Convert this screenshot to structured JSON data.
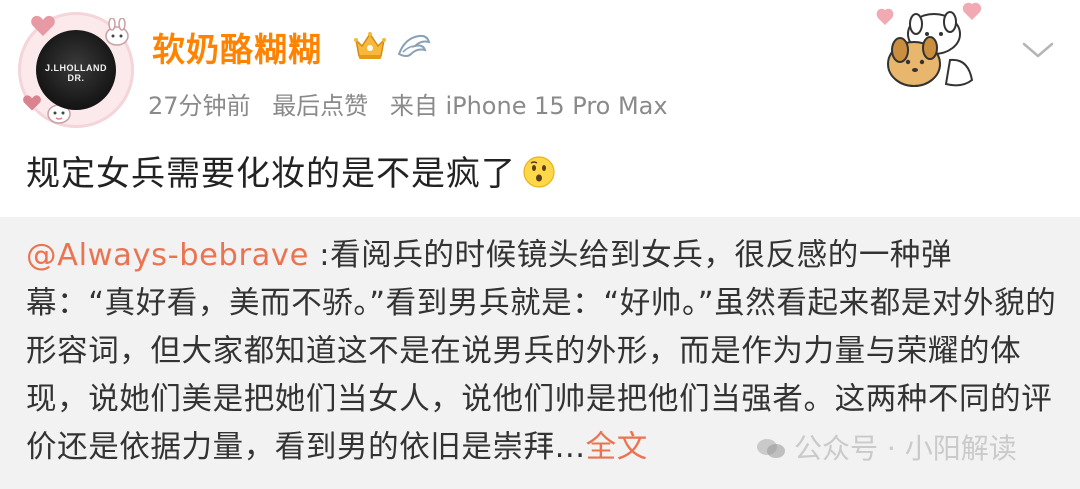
{
  "user": {
    "name": "软奶酪糊糊",
    "avatar_text": "J.LHOLLAND DR.",
    "avatar_frame_color": "#fbe9ec"
  },
  "meta": {
    "time": "27分钟前",
    "status": "最后点赞",
    "source": "来自 iPhone 15 Pro Max"
  },
  "post": {
    "text": "规定女兵需要化妆的是不是疯了",
    "emoji": "thinking-face-icon"
  },
  "retweet": {
    "mention": "@Always-bebrave",
    "text": " :看阅兵的时候镜头给到女兵，很反感的一种弹幕：“真好看，美而不骄。”看到男兵就是：“好帅。”虽然看起来都是对外貌的形容词，但大家都知道这不是在说男兵的外形，而是作为力量与荣耀的体现，说她们美是把她们当女人，说他们帅是把他们当强者。这两种不同的评价还是依据力量，看到男的依旧是崇拜...",
    "full_text_label": "全文"
  },
  "watermark": {
    "text": "公众号 · 小阳解读"
  },
  "colors": {
    "username": "#ff8200",
    "meta": "#8a8a8a",
    "mention": "#eb7350",
    "retweet_bg": "#f2f2f2"
  },
  "icons": [
    "crown-badge-icon",
    "fan-badge-icon",
    "chevron-down-icon",
    "dog-sticker-icon",
    "thinking-face-icon",
    "wechat-icon"
  ]
}
